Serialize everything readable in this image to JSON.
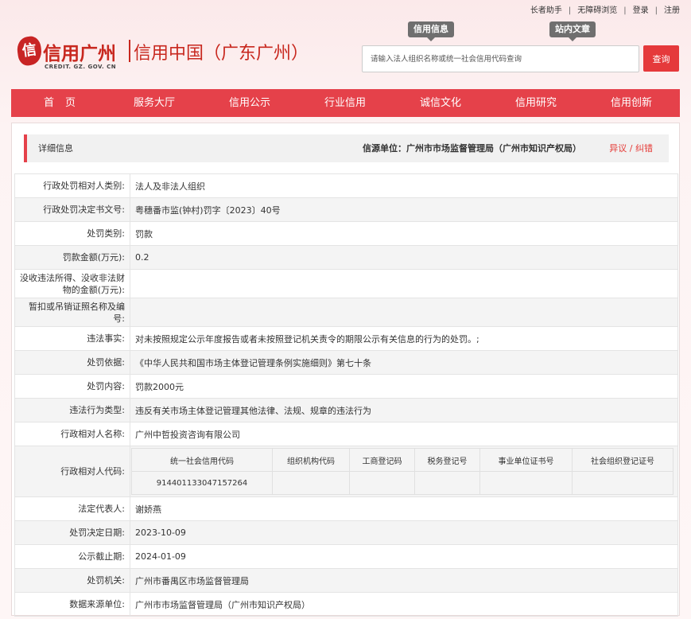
{
  "top_links": [
    "长者助手",
    "无障碍浏览",
    "登录",
    "注册"
  ],
  "logo": {
    "seal_char": "信",
    "name": "信用广州",
    "subtitle": "信用中国（广东广州）",
    "domain": "CREDIT. GZ. GOV. CN"
  },
  "search": {
    "tabs": [
      "信用信息",
      "站内文章"
    ],
    "placeholder": "请输入法人组织名称或统一社会信用代码查询",
    "button": "查询"
  },
  "nav": [
    "首页",
    "服务大厅",
    "信用公示",
    "行业信用",
    "诚信文化",
    "信用研究",
    "信用创新"
  ],
  "detail": {
    "title": "详细信息",
    "source_label": "信源单位：",
    "source_value": "广州市市场监督管理局（广州市知识产权局）",
    "objection": "异议 / 纠错"
  },
  "rows": [
    {
      "label": "行政处罚相对人类别:",
      "value": "法人及非法人组织"
    },
    {
      "label": "行政处罚决定书文号:",
      "value": "粤穗番市监(钟村)罚字〔2023〕40号"
    },
    {
      "label": "处罚类别:",
      "value": "罚款"
    },
    {
      "label": "罚款金额(万元):",
      "value": "0.2"
    },
    {
      "label": "没收违法所得、没收非法财物的金额(万元):",
      "value": ""
    },
    {
      "label": "暂扣或吊销证照名称及编号:",
      "value": ""
    },
    {
      "label": "违法事实:",
      "value": "对未按照规定公示年度报告或者未按照登记机关责令的期限公示有关信息的行为的处罚。;"
    },
    {
      "label": "处罚依据:",
      "value": "《中华人民共和国市场主体登记管理条例实施细则》第七十条"
    },
    {
      "label": "处罚内容:",
      "value": "罚款2000元"
    },
    {
      "label": "违法行为类型:",
      "value": "违反有关市场主体登记管理其他法律、法规、规章的违法行为"
    },
    {
      "label": "行政相对人名称:",
      "value": "广州中哲投资咨询有限公司"
    }
  ],
  "code_row": {
    "label": "行政相对人代码:",
    "headers": [
      "统一社会信用代码",
      "组织机构代码",
      "工商登记码",
      "税务登记号",
      "事业单位证书号",
      "社会组织登记证号"
    ],
    "values": [
      "914401133047157264",
      "",
      "",
      "",
      "",
      ""
    ]
  },
  "rows_after": [
    {
      "label": "法定代表人:",
      "value": "谢娇燕"
    },
    {
      "label": "处罚决定日期:",
      "value": "2023-10-09"
    },
    {
      "label": "公示截止期:",
      "value": "2024-01-09"
    },
    {
      "label": "处罚机关:",
      "value": "广州市番禺区市场监督管理局"
    },
    {
      "label": "数据来源单位:",
      "value": "广州市市场监督管理局（广州市知识产权局）"
    }
  ]
}
